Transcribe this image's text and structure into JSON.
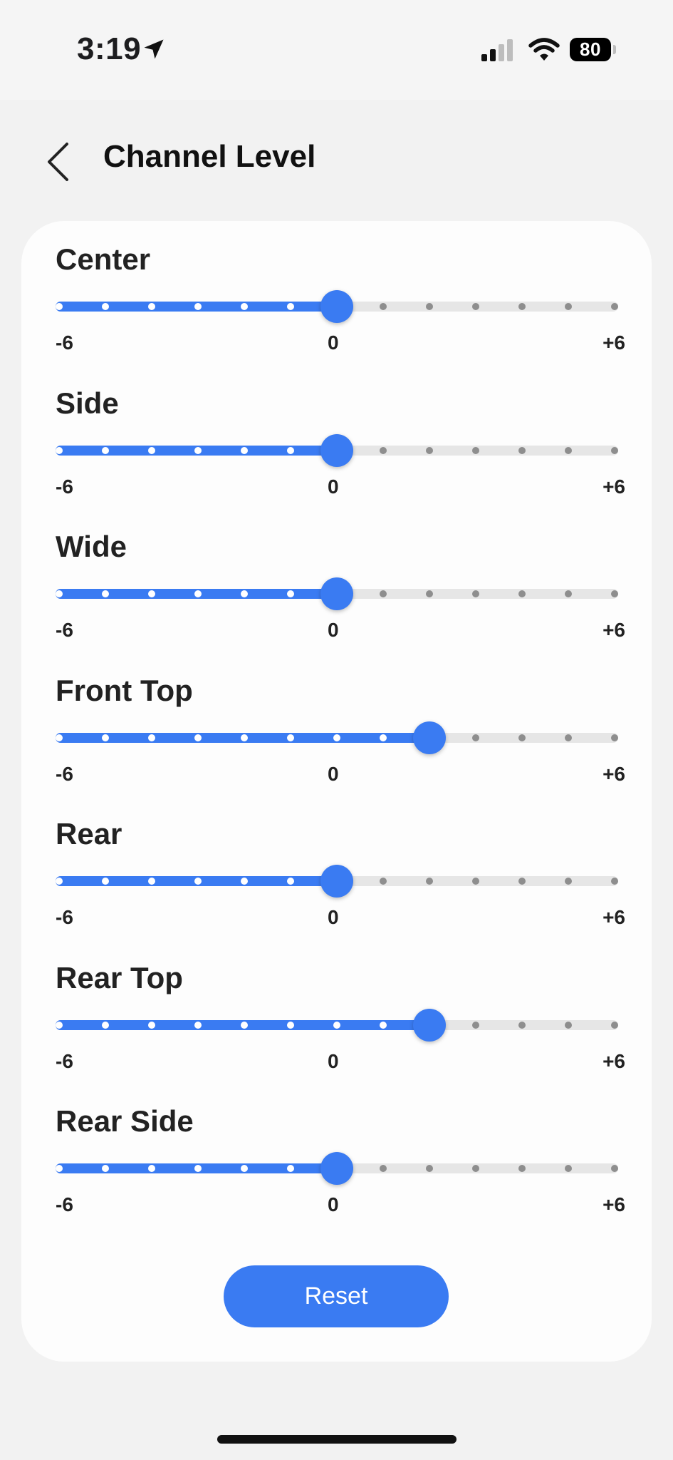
{
  "status_bar": {
    "time": "3:19",
    "battery": "80",
    "icons": [
      "location-arrow-icon",
      "cellular-signal-icon",
      "wifi-icon",
      "battery-icon"
    ]
  },
  "header": {
    "title": "Channel Level",
    "back_icon": "chevron-left-icon"
  },
  "colors": {
    "accent": "#3a7bf2",
    "track": "#e6e6e6",
    "tick_inactive": "#8e8e8e",
    "card_bg": "#fdfdfd",
    "page_bg": "#f2f2f2"
  },
  "slider_scale": {
    "min": -6,
    "max": 6,
    "min_label": "-6",
    "mid_label": "0",
    "max_label": "+6"
  },
  "channels": [
    {
      "label": "Center",
      "value": 0
    },
    {
      "label": "Side",
      "value": 0
    },
    {
      "label": "Wide",
      "value": 0
    },
    {
      "label": "Front Top",
      "value": 2
    },
    {
      "label": "Rear",
      "value": 0
    },
    {
      "label": "Rear Top",
      "value": 2
    },
    {
      "label": "Rear Side",
      "value": 0
    }
  ],
  "reset_label": "Reset"
}
